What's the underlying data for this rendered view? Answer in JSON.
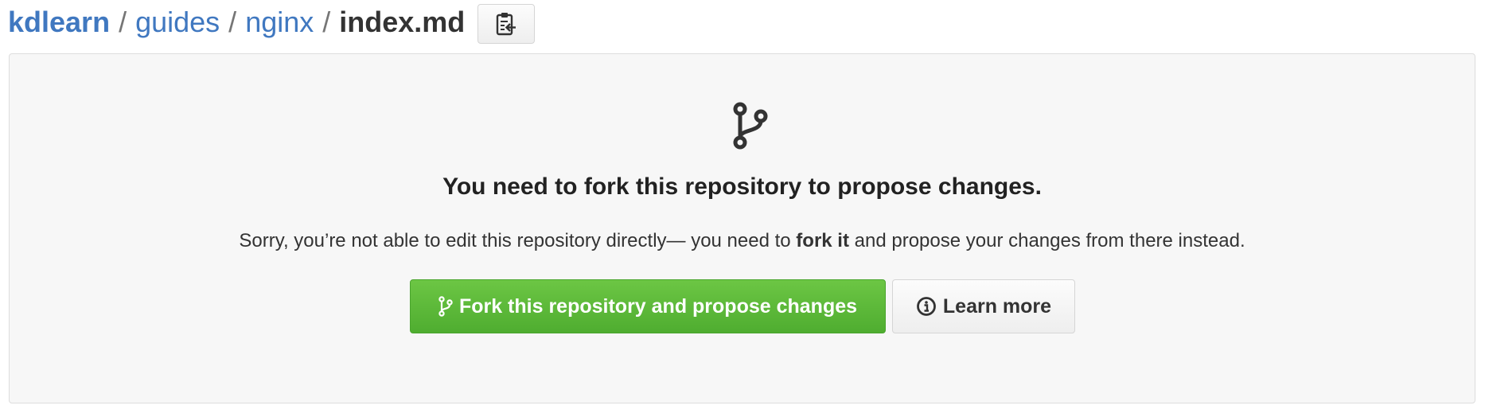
{
  "breadcrumb": {
    "owner": "kdlearn",
    "path": [
      "guides",
      "nginx"
    ],
    "separator": "/",
    "file": "index.md"
  },
  "icons": {
    "copy_path": "clippy-icon",
    "fork": "repo-forked-icon",
    "info": "info-icon"
  },
  "notice": {
    "title": "You need to fork this repository to propose changes.",
    "text_before": "Sorry, you’re not able to edit this repository directly— you need to ",
    "text_strong": "fork it",
    "text_after": " and propose your changes from there instead."
  },
  "actions": {
    "fork_label": "Fork this repository and propose changes",
    "learn_label": "Learn more"
  },
  "colors": {
    "link": "#4078c0",
    "primary_button": "#6cc644",
    "panel_background": "#f7f7f7"
  }
}
